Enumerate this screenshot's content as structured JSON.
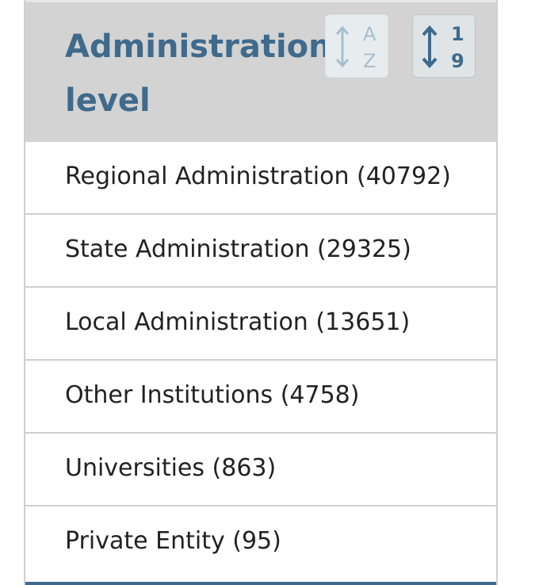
{
  "filter": {
    "title": "Administration level",
    "sort_alpha": {
      "icon": "sort-alpha-icon",
      "top_glyph": "A",
      "bottom_glyph": "Z"
    },
    "sort_numeric": {
      "icon": "sort-numeric-icon",
      "top_glyph": "1",
      "bottom_glyph": "9"
    },
    "items": [
      {
        "label": "Regional Administration (40792)"
      },
      {
        "label": "State Administration (29325)"
      },
      {
        "label": "Local Administration (13651)"
      },
      {
        "label": "Other Institutions (4758)"
      },
      {
        "label": "Universities (863)"
      },
      {
        "label": "Private Entity (95)"
      }
    ]
  },
  "colors": {
    "header_bg": "#d3d3d3",
    "title_text": "#3f6a8c",
    "item_text": "#222222",
    "divider": "#cfcfcf",
    "accent": "#3f6a8c"
  }
}
